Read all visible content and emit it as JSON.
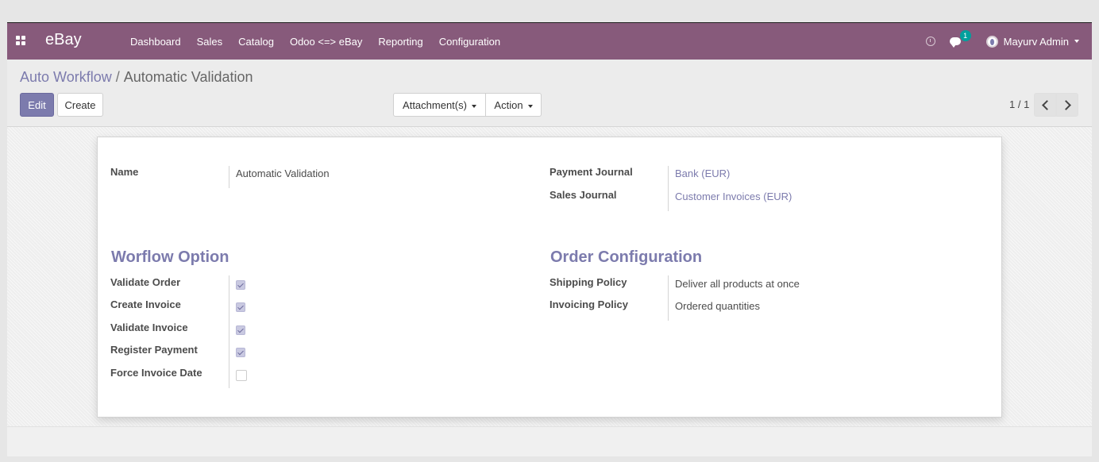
{
  "navbar": {
    "apps_icon": "apps-grid-icon",
    "brand": "eBay",
    "menu": [
      "Dashboard",
      "Sales",
      "Catalog",
      "Odoo <=> eBay",
      "Reporting",
      "Configuration"
    ],
    "activity_icon": "clock-icon",
    "messages_icon": "chat-icon",
    "messages_count": "1",
    "user_name": "Mayurv Admin",
    "bar_color": "#875a7b"
  },
  "breadcrumb": {
    "parent": "Auto Workflow",
    "separator": "/",
    "current": "Automatic Validation"
  },
  "buttons": {
    "edit": "Edit",
    "create": "Create",
    "attachments": "Attachment(s)",
    "action": "Action"
  },
  "pager": {
    "value": "1 / 1"
  },
  "form": {
    "name_label": "Name",
    "name_value": "Automatic Validation",
    "payment_journal_label": "Payment Journal",
    "payment_journal_value": "Bank (EUR)",
    "sales_journal_label": "Sales Journal",
    "sales_journal_value": "Customer Invoices (EUR)",
    "workflow_title": "Worflow Option",
    "workflow_options": [
      {
        "label": "Validate Order",
        "checked": true
      },
      {
        "label": "Create Invoice",
        "checked": true
      },
      {
        "label": "Validate Invoice",
        "checked": true
      },
      {
        "label": "Register Payment",
        "checked": true
      },
      {
        "label": "Force Invoice Date",
        "checked": false
      }
    ],
    "order_title": "Order Configuration",
    "shipping_policy_label": "Shipping Policy",
    "shipping_policy_value": "Deliver all products at once",
    "invoicing_policy_label": "Invoicing Policy",
    "invoicing_policy_value": "Ordered quantities"
  },
  "colors": {
    "accent": "#7c7bad",
    "navbar": "#875a7b"
  }
}
